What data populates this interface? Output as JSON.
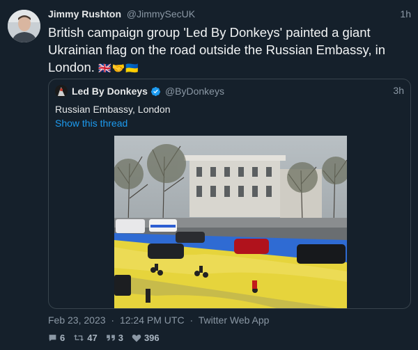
{
  "tweet": {
    "author_name": "Jimmy Rushton",
    "author_handle": "@JimmySecUK",
    "time": "1h",
    "text": "British campaign group 'Led By Donkeys' painted a giant Ukrainian flag on the road outside the Russian Embassy, in London.",
    "emojis": "🇬🇧🤝🇺🇦",
    "date": "Feb 23, 2023",
    "clock": "12:24 PM UTC",
    "source": "Twitter Web App",
    "dot": "·"
  },
  "quoted": {
    "author_name": "Led By Donkeys",
    "author_handle": "@ByDonkeys",
    "time": "3h",
    "text": "Russian Embassy, London",
    "thread_link": "Show this thread",
    "verified": true
  },
  "stats": {
    "replies": "6",
    "retweets": "47",
    "quotes": "3",
    "likes": "396"
  },
  "icons": {
    "reply": "speech-bubble-icon",
    "retweet": "retweet-icon",
    "quote": "quote-icon",
    "like": "heart-icon",
    "verified": "verified-badge-icon"
  },
  "colors": {
    "background": "#15202b",
    "link": "#1d9bf0",
    "muted": "#8b98a5",
    "flag_blue": "#2f6bd3",
    "flag_yellow": "#e6d43c"
  }
}
